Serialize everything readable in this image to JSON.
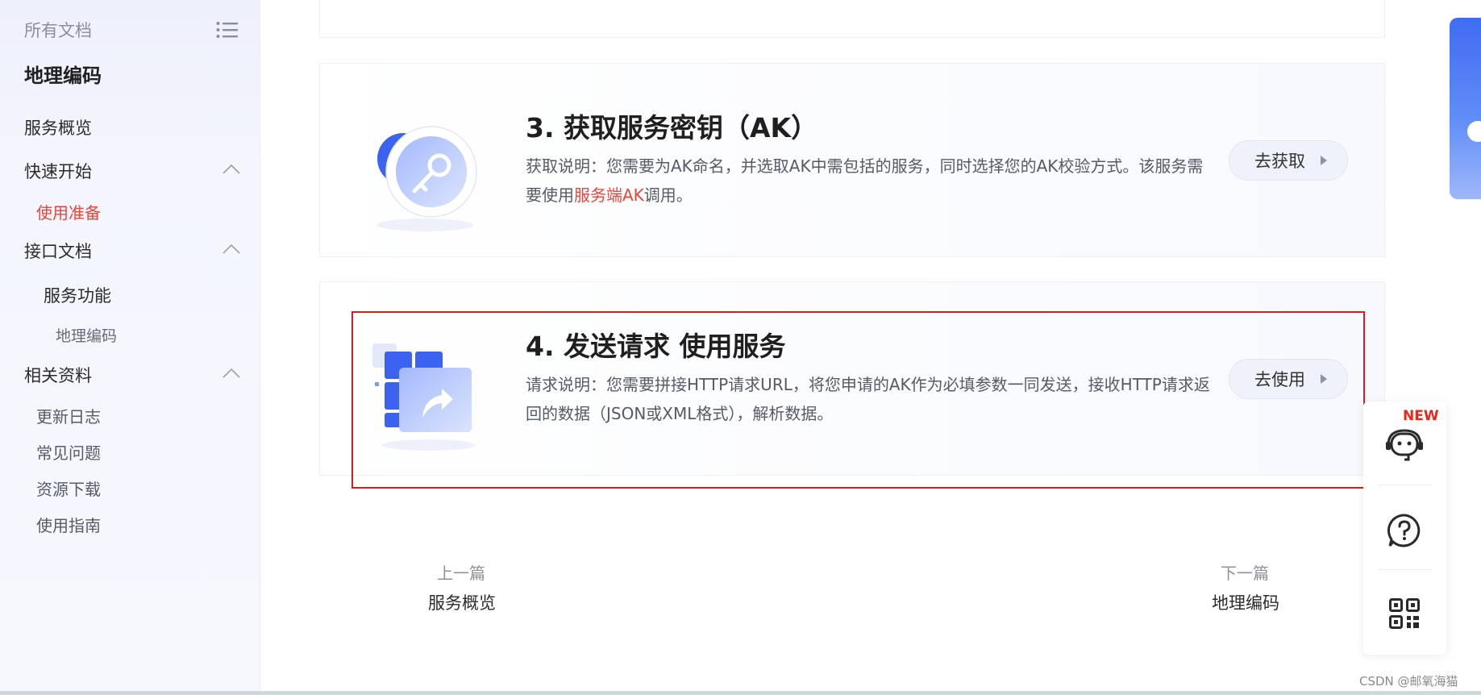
{
  "sidebar": {
    "top_label": "所有文档",
    "menu_icon": "list-icon",
    "title": "地理编码",
    "items": {
      "overview": "服务概览",
      "quick_start": "快速开始",
      "prep": "使用准备",
      "api_docs": "接口文档",
      "service_func": "服务功能",
      "geocoding": "地理编码",
      "related": "相关资料",
      "changelog": "更新日志",
      "faq": "常见问题",
      "downloads": "资源下载",
      "guide": "使用指南"
    }
  },
  "step3": {
    "title": "3. 获取服务密钥（AK）",
    "desc_prefix": "获取说明：您需要为AK命名，并选取AK中需包括的服务，同时选择您的AK校验方式。该服务需要使用",
    "desc_link": "服务端AK",
    "desc_suffix": "调用。",
    "button": "去获取",
    "icon": "key-icon"
  },
  "step4": {
    "title": "4. 发送请求 使用服务",
    "desc": "请求说明：您需要拼接HTTP请求URL，将您申请的AK作为必填参数一同发送，接收HTTP请求返回的数据（JSON或XML格式），解析数据。",
    "button": "去使用",
    "icon": "share-arrow-icon"
  },
  "pager": {
    "prev_caption": "上一篇",
    "prev_link": "服务概览",
    "next_caption": "下一篇",
    "next_link": "地理编码"
  },
  "float_bar": {
    "badge": "NEW",
    "icons": [
      "robot-assistant-icon",
      "help-question-icon",
      "qr-code-icon"
    ]
  },
  "watermark": "CSDN @邮氧海猫",
  "colors": {
    "accent_red": "#e8453c",
    "frame_red": "#dd1b1b",
    "brand_blue": "#3f6df2"
  }
}
